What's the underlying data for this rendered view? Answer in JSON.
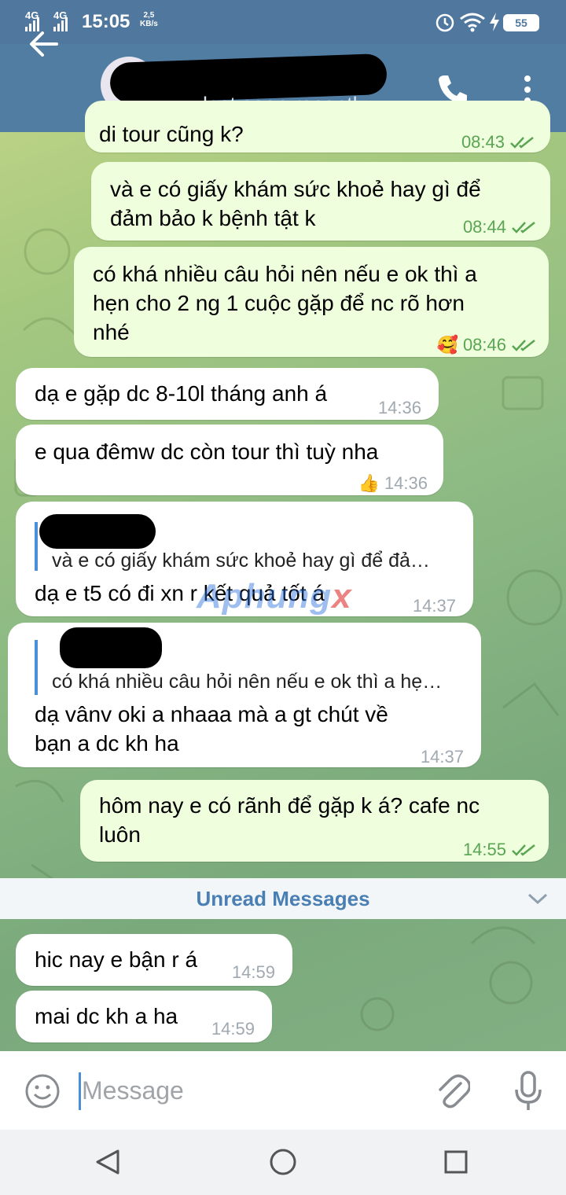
{
  "status_bar": {
    "signal1": "4G",
    "signal2": "4G",
    "time": "15:05",
    "speed_value": "2,5",
    "speed_unit": "KB/s",
    "battery": "55"
  },
  "header": {
    "last_seen": "last seen recently"
  },
  "messages": [
    {
      "text": "di tour cũng k?",
      "time": "08:43"
    },
    {
      "text": "và e có giấy khám sức khoẻ hay gì để\nđảm bảo k bệnh tật k",
      "time": "08:44"
    },
    {
      "text": "có khá nhiều câu hỏi nên nếu e ok thì a\nhẹn cho 2 ng 1 cuộc gặp để nc rõ hơn\nnhé",
      "time": "08:46",
      "reaction": "🥰"
    },
    {
      "text": "dạ e gặp dc 8-10l tháng anh á",
      "time": "14:36"
    },
    {
      "text": "e qua đêmw dc còn tour thì tuỳ nha",
      "time": "14:36",
      "reaction": "👍"
    },
    {
      "reply_quote": "và e có giấy khám sức khoẻ hay gì để đả…",
      "text": "dạ e t5 có đi xn r kết quả tốt á",
      "time": "14:37"
    },
    {
      "reply_quote": "có khá nhiều câu hỏi nên nếu e ok thì a hẹ…",
      "text": "dạ vânv oki a nhaaa mà a gt chút về\nbạn a dc kh ha",
      "time": "14:37"
    },
    {
      "text": "hôm nay e có rãnh để gặp k á? cafe nc\nluôn",
      "time": "14:55"
    },
    {
      "text": "hic nay e bận r á",
      "time": "14:59"
    },
    {
      "text": "mai dc kh a ha",
      "time": "14:59"
    }
  ],
  "unread_label": "Unread Messages",
  "watermark": {
    "part1": "Aphung",
    "part2": "x"
  },
  "composer": {
    "placeholder": "Message"
  },
  "colors": {
    "header": "#527da3",
    "outgoing_bubble": "#effedd",
    "incoming_bubble": "#ffffff",
    "accent": "#4a90d9",
    "check_green": "#5aa553"
  },
  "icons": [
    "back-arrow-icon",
    "phone-icon",
    "more-vertical-icon",
    "double-check-icon",
    "chevron-down-icon",
    "emoji-icon",
    "attach-icon",
    "mic-icon",
    "nav-back-icon",
    "nav-home-icon",
    "nav-recent-icon",
    "wifi-icon",
    "alarm-icon",
    "battery-icon"
  ]
}
